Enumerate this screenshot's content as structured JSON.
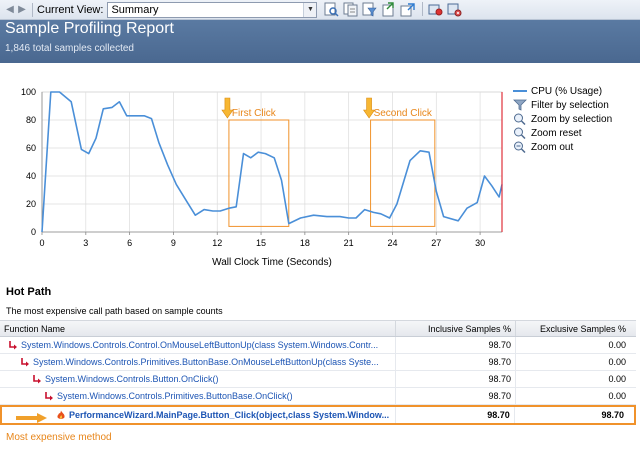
{
  "toolbar": {
    "current_view_label": "Current View:",
    "current_view_value": "Summary"
  },
  "header": {
    "title": "Sample Profiling Report",
    "subtitle": "1,846 total samples collected"
  },
  "chart_data": {
    "type": "line",
    "xlabel": "Wall Clock Time (Seconds)",
    "ylabel": "",
    "xlim": [
      0,
      31.5
    ],
    "ylim": [
      0,
      100
    ],
    "x_ticks": [
      0,
      3,
      6,
      9,
      12,
      15,
      18,
      21,
      24,
      27,
      30
    ],
    "y_ticks": [
      0,
      20,
      40,
      60,
      80,
      100
    ],
    "series": [
      {
        "name": "CPU (% Usage)",
        "color": "#4a8fd8",
        "points": [
          [
            0,
            0
          ],
          [
            0.6,
            100
          ],
          [
            1.2,
            100
          ],
          [
            2,
            93
          ],
          [
            2.7,
            59
          ],
          [
            3.2,
            56
          ],
          [
            3.7,
            67
          ],
          [
            4.2,
            88
          ],
          [
            4.8,
            89
          ],
          [
            5.3,
            93
          ],
          [
            5.8,
            83
          ],
          [
            6.4,
            83
          ],
          [
            7,
            83
          ],
          [
            7.5,
            81
          ],
          [
            8,
            64
          ],
          [
            8.6,
            48
          ],
          [
            9.2,
            34
          ],
          [
            9.9,
            22
          ],
          [
            10.5,
            12
          ],
          [
            11.1,
            16
          ],
          [
            11.7,
            15
          ],
          [
            12.2,
            15
          ],
          [
            12.8,
            17
          ],
          [
            13.3,
            18
          ],
          [
            13.8,
            56
          ],
          [
            14.3,
            53
          ],
          [
            14.8,
            57
          ],
          [
            15.3,
            56
          ],
          [
            15.9,
            53
          ],
          [
            16.4,
            37
          ],
          [
            16.9,
            6
          ],
          [
            17.7,
            10
          ],
          [
            18.6,
            12
          ],
          [
            19.5,
            11
          ],
          [
            20.4,
            11
          ],
          [
            21,
            10
          ],
          [
            21.5,
            10
          ],
          [
            22.1,
            16
          ],
          [
            22.7,
            14
          ],
          [
            23.2,
            13
          ],
          [
            23.8,
            10
          ],
          [
            24.3,
            20
          ],
          [
            25.2,
            51
          ],
          [
            25.9,
            58
          ],
          [
            26.5,
            57
          ],
          [
            27,
            29
          ],
          [
            27.5,
            11
          ],
          [
            28.5,
            8
          ],
          [
            29.1,
            17
          ],
          [
            29.8,
            21
          ],
          [
            30.3,
            40
          ],
          [
            30.8,
            33
          ],
          [
            31.3,
            25
          ],
          [
            31.5,
            34
          ]
        ]
      }
    ],
    "annotations": [
      {
        "label": "First Click",
        "x_range": [
          12.8,
          16.9
        ],
        "y_range": [
          4,
          80
        ]
      },
      {
        "label": "Second Click",
        "x_range": [
          22.5,
          26.9
        ],
        "y_range": [
          4,
          80
        ]
      }
    ],
    "legend_position": "right",
    "grid": true
  },
  "legend": {
    "items": [
      {
        "label": "CPU (% Usage)"
      },
      {
        "label": "Filter by selection"
      },
      {
        "label": "Zoom by selection"
      },
      {
        "label": "Zoom reset"
      },
      {
        "label": "Zoom out"
      }
    ]
  },
  "hot_path": {
    "title": "Hot Path",
    "description": "The most expensive call path based on sample counts",
    "columns": {
      "function": "Function Name",
      "inclusive": "Inclusive Samples %",
      "exclusive": "Exclusive Samples %"
    },
    "rows": [
      {
        "name": "System.Windows.Controls.Control.OnMouseLeftButtonUp(class System.Windows.Contr...",
        "inclusive": "98.70",
        "exclusive": "0.00"
      },
      {
        "name": "System.Windows.Controls.Primitives.ButtonBase.OnMouseLeftButtonUp(class Syste...",
        "inclusive": "98.70",
        "exclusive": "0.00"
      },
      {
        "name": "System.Windows.Controls.Button.OnClick()",
        "inclusive": "98.70",
        "exclusive": "0.00"
      },
      {
        "name": "System.Windows.Controls.Primitives.ButtonBase.OnClick()",
        "inclusive": "98.70",
        "exclusive": "0.00"
      },
      {
        "name": "PerformanceWizard.MainPage.Button_Click(object,class System.Window...",
        "inclusive": "98.70",
        "exclusive": "98.70"
      }
    ],
    "caption": "Most expensive method"
  },
  "colors": {
    "header_bg": "#4f6e96",
    "series": "#4a8fd8",
    "annotation": "#e8861a",
    "link": "#1d55b4",
    "arrow": "#c8102e"
  }
}
